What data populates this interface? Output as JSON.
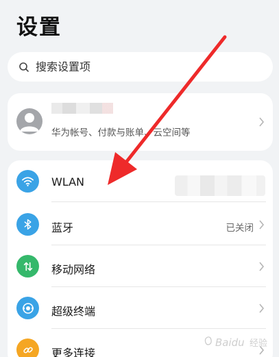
{
  "header": {
    "title": "设置"
  },
  "search": {
    "placeholder": "搜索设置项",
    "icon": "search-icon"
  },
  "account": {
    "description": "华为帐号、付款与账单、云空间等",
    "avatar_icon": "person-avatar-icon"
  },
  "settings": {
    "items": [
      {
        "label": "WLAN",
        "value": "",
        "icon": "wifi-icon",
        "icon_color": "#3aa3e6"
      },
      {
        "label": "蓝牙",
        "value": "已关闭",
        "icon": "bluetooth-icon",
        "icon_color": "#3aa3e6"
      },
      {
        "label": "移动网络",
        "value": "",
        "icon": "mobile-data-icon",
        "icon_color": "#35b86b"
      },
      {
        "label": "超级终端",
        "value": "",
        "icon": "super-device-icon",
        "icon_color": "#3aa3e6"
      },
      {
        "label": "更多连接",
        "value": "",
        "icon": "link-icon",
        "icon_color": "#f5a623"
      }
    ]
  },
  "annotation": {
    "arrow_color": "#ee2a2a"
  },
  "watermark": {
    "text": "Baidu 经验"
  }
}
